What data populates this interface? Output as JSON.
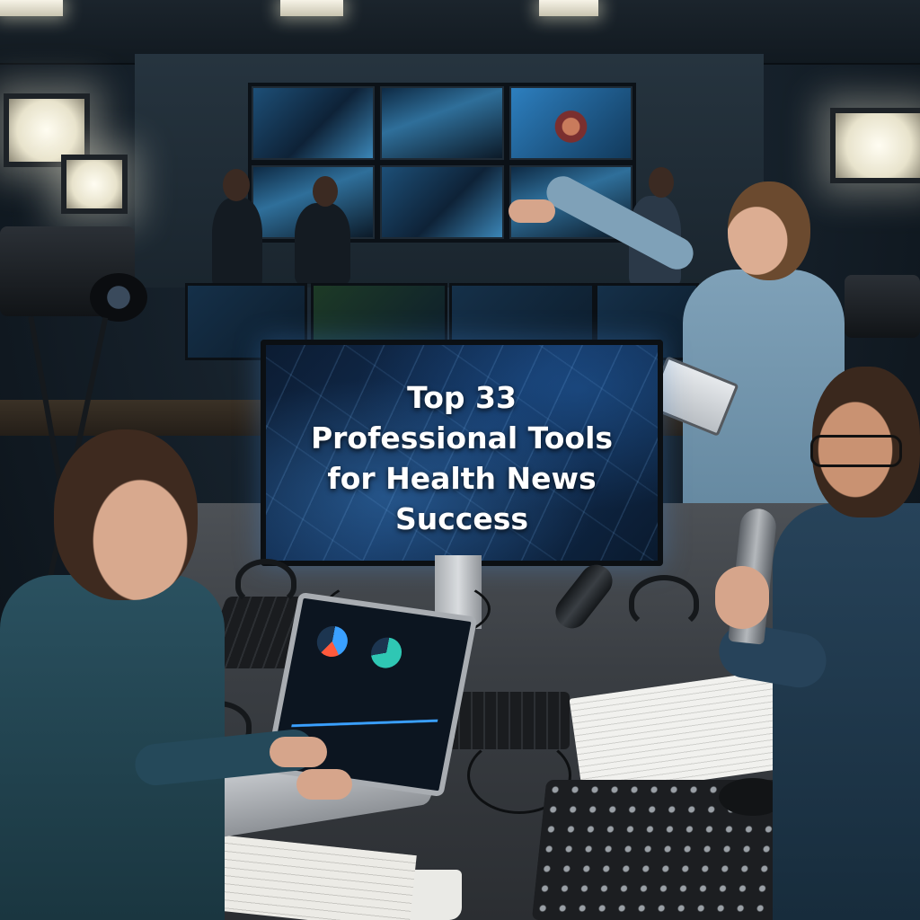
{
  "image": {
    "title_lines": [
      "Top 33",
      "Professional Tools",
      "for Health News",
      "Success"
    ]
  },
  "colors": {
    "screen_glow": "#3b86b7",
    "title_text": "#ffffff",
    "background": "#0d141b"
  },
  "icons": [
    "video-camera-icon",
    "microphone-icon",
    "headphones-icon",
    "laptop-icon",
    "mixer-icon",
    "tablet-icon"
  ]
}
